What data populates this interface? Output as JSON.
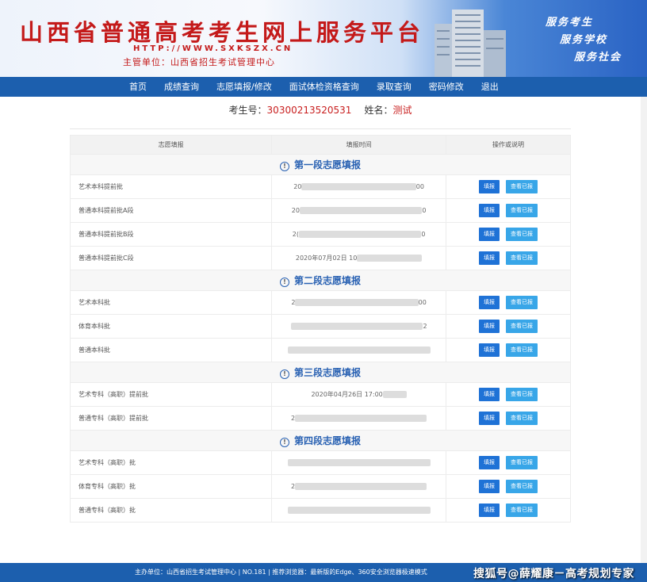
{
  "header": {
    "title": "山西省普通高考考生网上服务平台",
    "url": "HTTP://WWW.SXKSZX.CN",
    "org": "主管单位：山西省招生考试管理中心",
    "slogans": [
      "服务考生",
      "服务学校",
      "服务社会"
    ]
  },
  "nav": [
    "首页",
    "成绩查询",
    "志愿填报/修改",
    "面试体检资格查询",
    "录取查询",
    "密码修改",
    "退出"
  ],
  "student": {
    "id_label": "考生号：",
    "id": "30300213520531",
    "name_label": "姓名：",
    "name": "测试"
  },
  "table": {
    "headers": [
      "志愿填报",
      "填报时间",
      "操作或说明"
    ],
    "fill_label": "填报",
    "view_label": "查看已报",
    "sections": [
      {
        "title": "第一段志愿填报",
        "rows": [
          {
            "name": "艺术本科提前批",
            "time_start": "20",
            "time_end": "00"
          },
          {
            "name": "普通本科提前批A段",
            "time_start": "20",
            "time_end": "0"
          },
          {
            "name": "普通本科提前批B段",
            "time_start": "2(",
            "time_end": "0"
          },
          {
            "name": "普通本科提前批C段",
            "time_start": "2020年07月02日 10",
            "time_end": ""
          }
        ]
      },
      {
        "title": "第二段志愿填报",
        "rows": [
          {
            "name": "艺术本科批",
            "time_start": "2",
            "time_end": "00"
          },
          {
            "name": "体育本科批",
            "time_start": "",
            "time_end": "2"
          },
          {
            "name": "普通本科批",
            "time_start": "",
            "time_end": ""
          }
        ]
      },
      {
        "title": "第三段志愿填报",
        "rows": [
          {
            "name": "艺术专科（高职）提前批",
            "time_start": "2020年04月26日 17:00",
            "time_end": ""
          },
          {
            "name": "普通专科（高职）提前批",
            "time_start": "2",
            "time_end": ""
          }
        ]
      },
      {
        "title": "第四段志愿填报",
        "rows": [
          {
            "name": "艺术专科（高职）批",
            "time_start": "",
            "time_end": ""
          },
          {
            "name": "体育专科（高职）批",
            "time_start": "2",
            "time_end": ""
          },
          {
            "name": "普通专科（高职）批",
            "time_start": "",
            "time_end": ""
          }
        ]
      }
    ]
  },
  "footer": {
    "text": "主办单位：山西省招生考试管理中心  |  NO.181  |  推荐浏览器：最新版的Edge、360安全浏览器极速模式",
    "watermark": "搜狐号@薛耀康－高考规划专家"
  },
  "colors": {
    "nav_bg": "#1c5fae",
    "title_red": "#c41a1a",
    "accent_blue": "#2a62b3",
    "btn_fill": "#1f72d6",
    "btn_view": "#38a6e8"
  }
}
